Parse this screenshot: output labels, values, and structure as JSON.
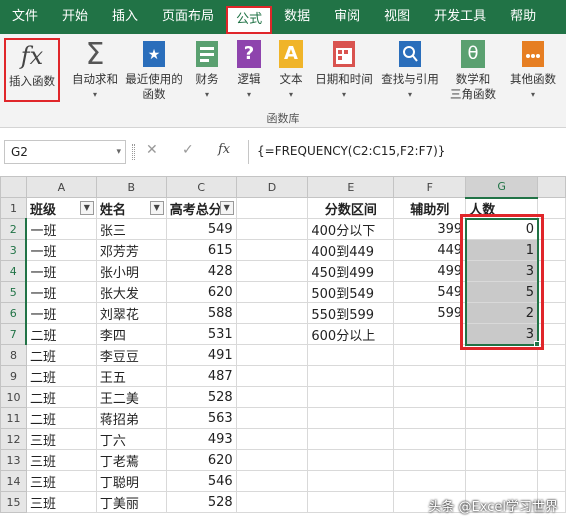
{
  "menu": {
    "items": [
      "文件",
      "开始",
      "插入",
      "页面布局",
      "公式",
      "数据",
      "审阅",
      "视图",
      "开发工具",
      "帮助"
    ],
    "active_index": 4
  },
  "ribbon": {
    "insert_function": {
      "icon_text": "fx",
      "label": "插入函数"
    },
    "autosum": {
      "icon_text": "Σ",
      "label": "自动求和"
    },
    "recent": {
      "line1": "最近使用的",
      "line2": "函数"
    },
    "finance": {
      "label": "财务"
    },
    "logic": {
      "label": "逻辑",
      "icon_text": "?"
    },
    "text": {
      "label": "文本",
      "icon_text": "A"
    },
    "datetime": {
      "label": "日期和时间"
    },
    "lookup": {
      "label": "查找与引用"
    },
    "math": {
      "line1": "数学和",
      "line2": "三角函数",
      "icon_text": "θ"
    },
    "other": {
      "label": "其他函数"
    },
    "group_label": "函数库"
  },
  "formula_bar": {
    "name_box": "G2",
    "cancel": "✕",
    "enter": "✓",
    "fx": "fx",
    "formula": "{=FREQUENCY(C2:C15,F2:F7)}"
  },
  "sheet": {
    "columns": [
      "A",
      "B",
      "C",
      "D",
      "E",
      "F",
      "G"
    ],
    "selected_column": "G",
    "row_numbers": [
      "1",
      "2",
      "3",
      "4",
      "5",
      "6",
      "7",
      "8",
      "9",
      "10",
      "11",
      "12",
      "13",
      "14",
      "15"
    ],
    "header_row": {
      "a": "班级",
      "b": "姓名",
      "c": "高考总分",
      "e": "分数区间",
      "f": "辅助列",
      "g": "人数"
    },
    "rows": [
      {
        "a": "一班",
        "b": "张三",
        "c": "549",
        "e": "400分以下",
        "f": "399",
        "g": "0"
      },
      {
        "a": "一班",
        "b": "邓芳芳",
        "c": "615",
        "e": "400到449",
        "f": "449",
        "g": "1"
      },
      {
        "a": "一班",
        "b": "张小明",
        "c": "428",
        "e": "450到499",
        "f": "499",
        "g": "3"
      },
      {
        "a": "一班",
        "b": "张大发",
        "c": "620",
        "e": "500到549",
        "f": "549",
        "g": "5"
      },
      {
        "a": "一班",
        "b": "刘翠花",
        "c": "588",
        "e": "550到599",
        "f": "599",
        "g": "2"
      },
      {
        "a": "二班",
        "b": "李四",
        "c": "531",
        "e": "600分以上",
        "f": "",
        "g": "3"
      },
      {
        "a": "二班",
        "b": "李豆豆",
        "c": "491",
        "e": "",
        "f": "",
        "g": ""
      },
      {
        "a": "二班",
        "b": "王五",
        "c": "487",
        "e": "",
        "f": "",
        "g": ""
      },
      {
        "a": "二班",
        "b": "王二美",
        "c": "528",
        "e": "",
        "f": "",
        "g": ""
      },
      {
        "a": "二班",
        "b": "蒋招弟",
        "c": "563",
        "e": "",
        "f": "",
        "g": ""
      },
      {
        "a": "三班",
        "b": "丁六",
        "c": "493",
        "e": "",
        "f": "",
        "g": ""
      },
      {
        "a": "三班",
        "b": "丁老蔫",
        "c": "620",
        "e": "",
        "f": "",
        "g": ""
      },
      {
        "a": "三班",
        "b": "丁聪明",
        "c": "546",
        "e": "",
        "f": "",
        "g": ""
      },
      {
        "a": "三班",
        "b": "丁美丽",
        "c": "528",
        "e": "",
        "f": "",
        "g": ""
      }
    ]
  },
  "watermark": "头条 @Excel学习世界",
  "colors": {
    "excel_green": "#217346",
    "highlight_red": "#e0262a"
  }
}
